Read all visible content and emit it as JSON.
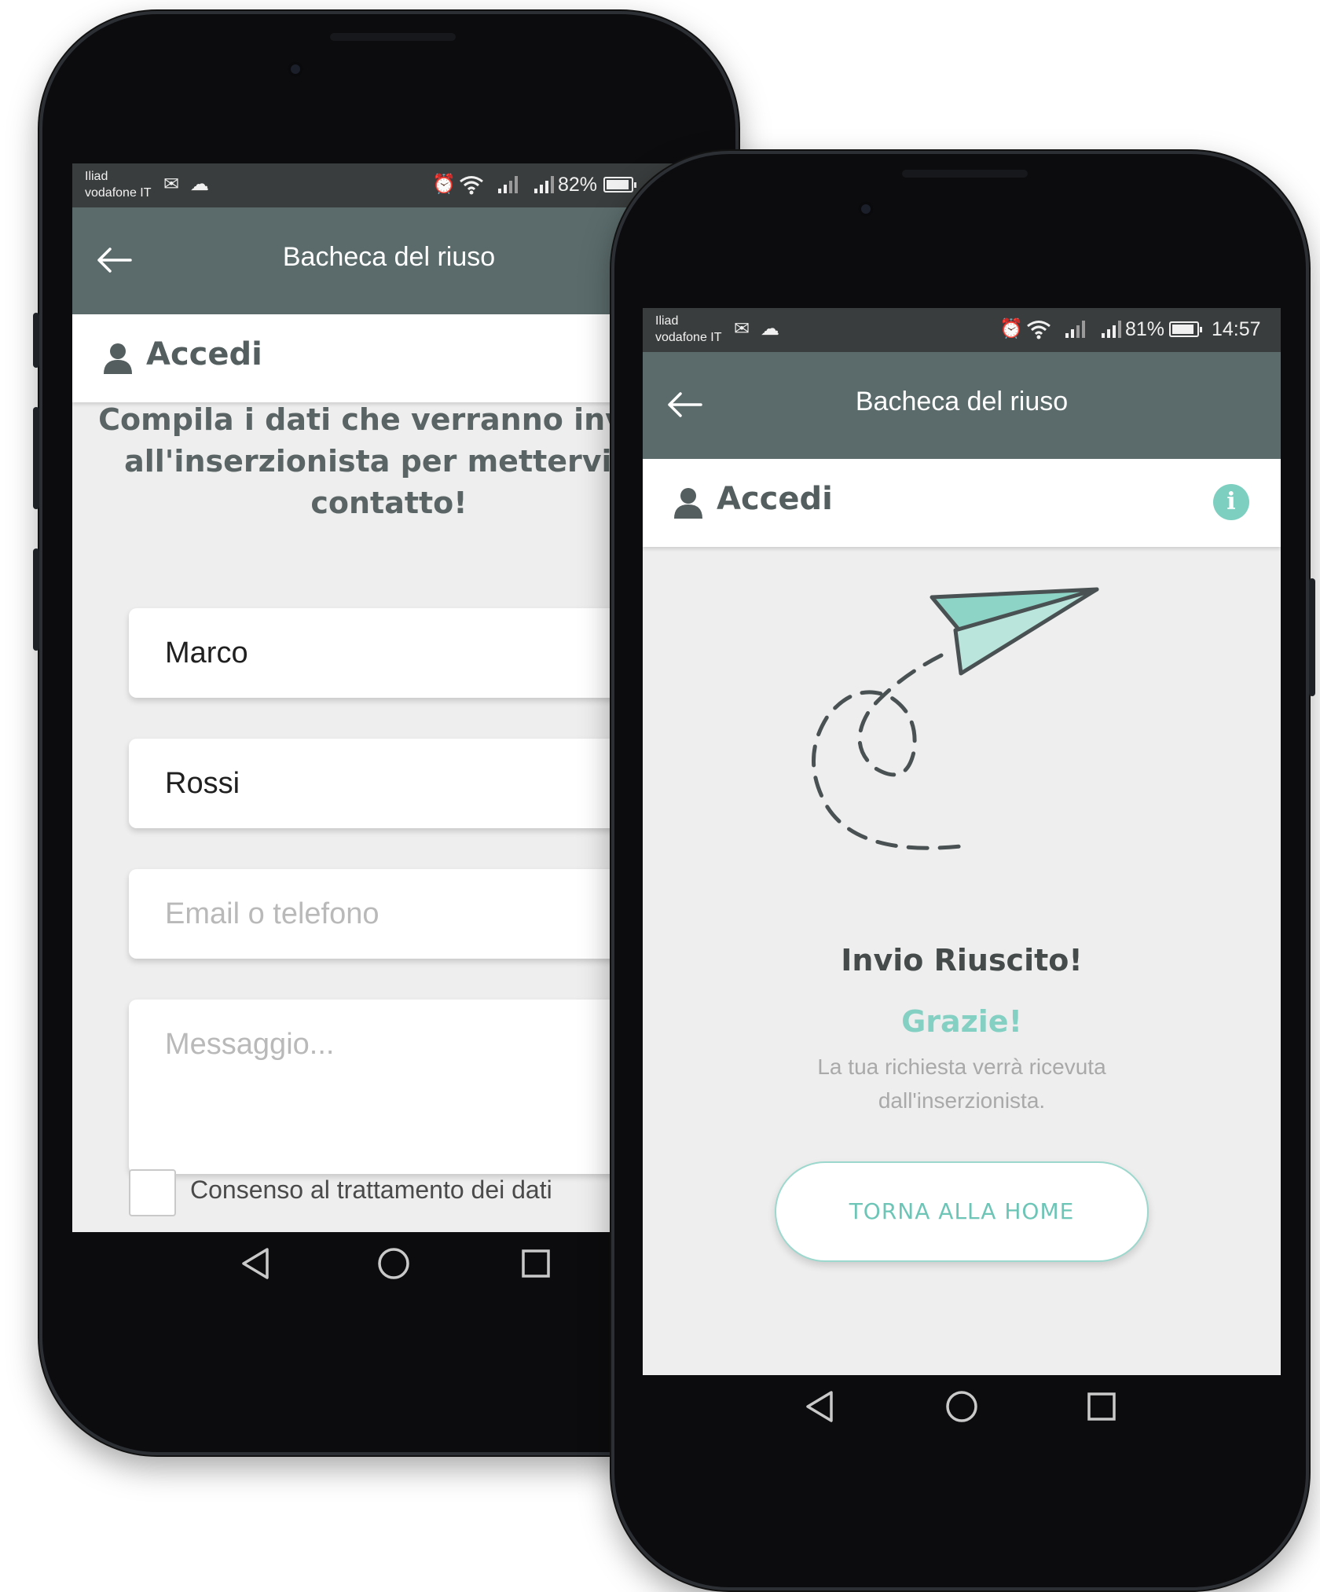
{
  "phone_left": {
    "status": {
      "carrier1": "Iliad",
      "carrier2": "vodafone IT",
      "battery": "82%"
    },
    "app_title": "Bacheca del riuso",
    "section_title": "Accedi",
    "intro": "Compila i dati che verranno inviati all'inserzionista per mettervi in contatto!",
    "form": {
      "first_name": "Marco",
      "last_name": "Rossi",
      "contact_placeholder": "Email o telefono",
      "message_placeholder": "Messaggio...",
      "consent_label": "Consenso al trattamento dei dati"
    }
  },
  "phone_right": {
    "status": {
      "carrier1": "Iliad",
      "carrier2": "vodafone IT",
      "battery": "81%",
      "time": "14:57"
    },
    "app_title": "Bacheca del riuso",
    "section_title": "Accedi",
    "success_title": "Invio Riuscito!",
    "thanks": "Grazie!",
    "message": "La tua richiesta verrà ricevuta dall'inserzionista.",
    "home_button": "TORNA ALLA HOME"
  },
  "icons": {
    "back": "arrow-left-icon",
    "user": "user-icon",
    "info": "info-icon",
    "illustration": "paper-plane-icon",
    "nav_back": "triangle-back-icon",
    "nav_home": "circle-home-icon",
    "nav_recent": "square-recents-icon"
  },
  "colors": {
    "app_bar": "#5b6b6b",
    "status_bar": "#3a3d3d",
    "accent": "#84d0c3",
    "background": "#eeeeee"
  }
}
